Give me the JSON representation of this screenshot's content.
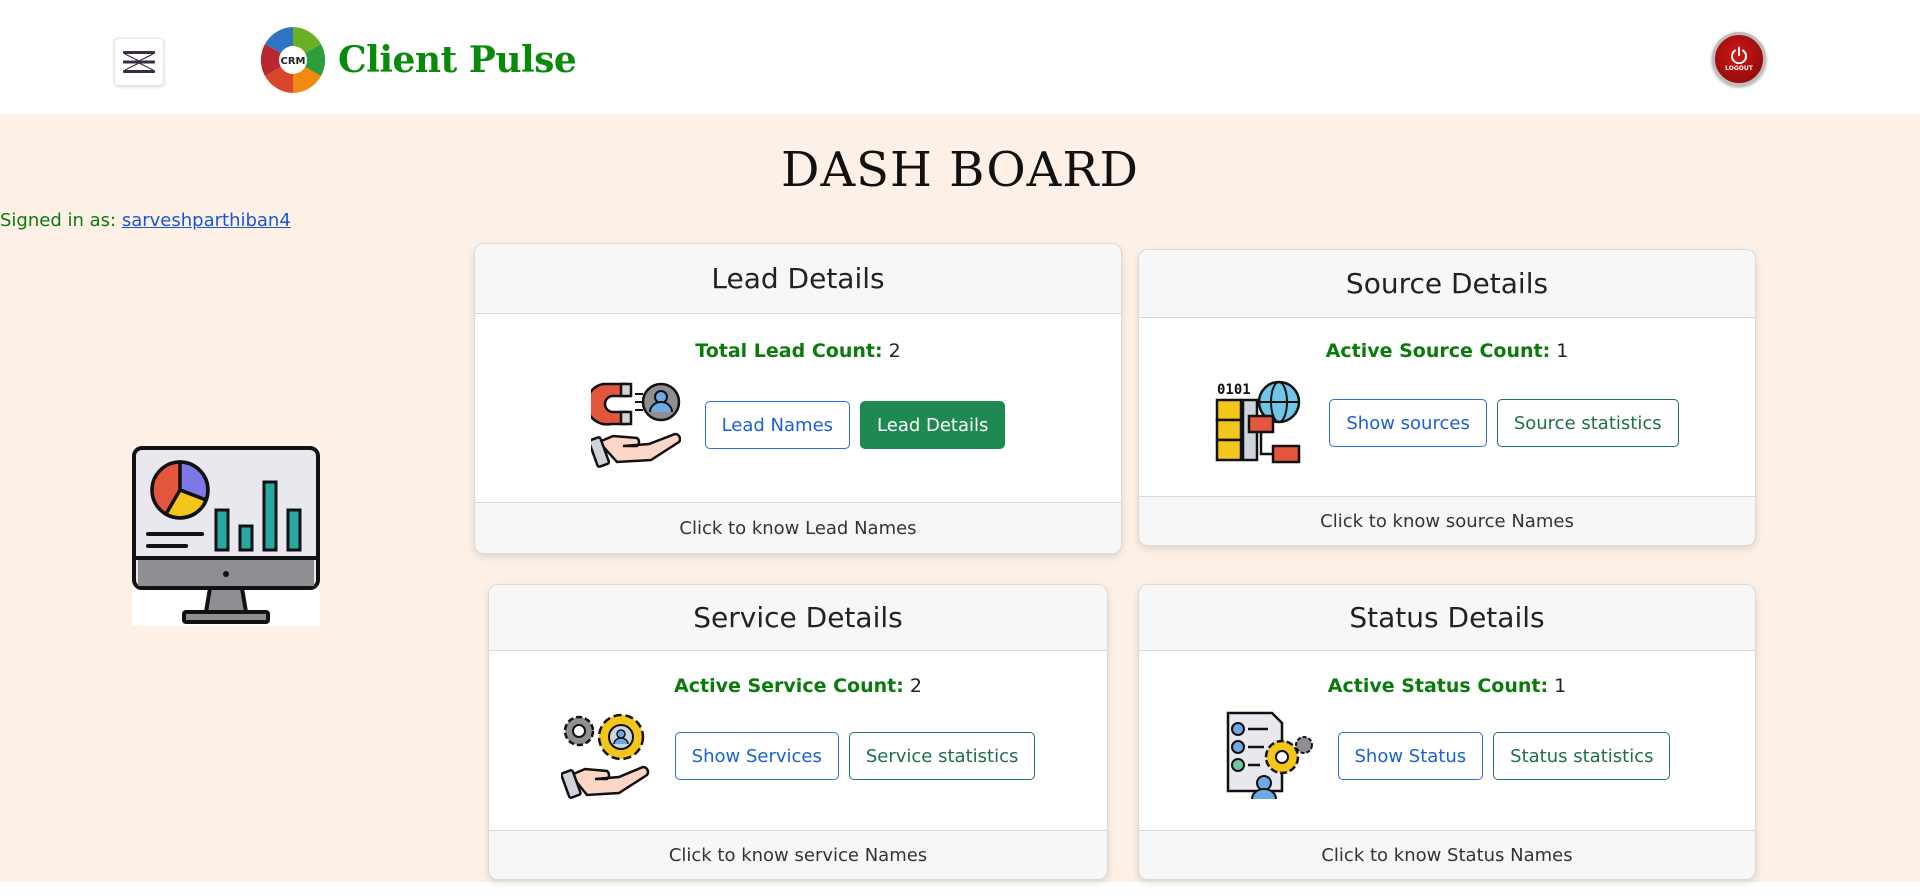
{
  "navbar": {
    "brand_name": "Client Pulse",
    "logo_text": "CRM",
    "logout_label": "LOGOUT",
    "accent_color": "#0a8a0a"
  },
  "main": {
    "title": "DASH BOARD",
    "signed_in_label": "Signed in as:",
    "username": "sarveshparthiban4"
  },
  "cards": {
    "lead": {
      "header": "Lead Details",
      "count_label": "Total Lead Count:",
      "count_value": "2",
      "icon": "magnet-lead-icon",
      "btn1": "Lead Names",
      "btn2": "Lead Details",
      "footer": "Click to know Lead Names"
    },
    "source": {
      "header": "Source Details",
      "count_label": "Active Source Count:",
      "count_value": "1",
      "icon": "server-globe-icon",
      "btn1": "Show sources",
      "btn2": "Source statistics",
      "footer": "Click to know source Names"
    },
    "service": {
      "header": "Service Details",
      "count_label": "Active Service Count:",
      "count_value": "2",
      "icon": "gears-hand-icon",
      "btn1": "Show Services",
      "btn2": "Service statistics",
      "footer": "Click to know service Names"
    },
    "status": {
      "header": "Status Details",
      "count_label": "Active Status Count:",
      "count_value": "1",
      "icon": "checklist-gear-icon",
      "btn1": "Show Status",
      "btn2": "Status statistics",
      "footer": "Click to know Status Names"
    }
  }
}
